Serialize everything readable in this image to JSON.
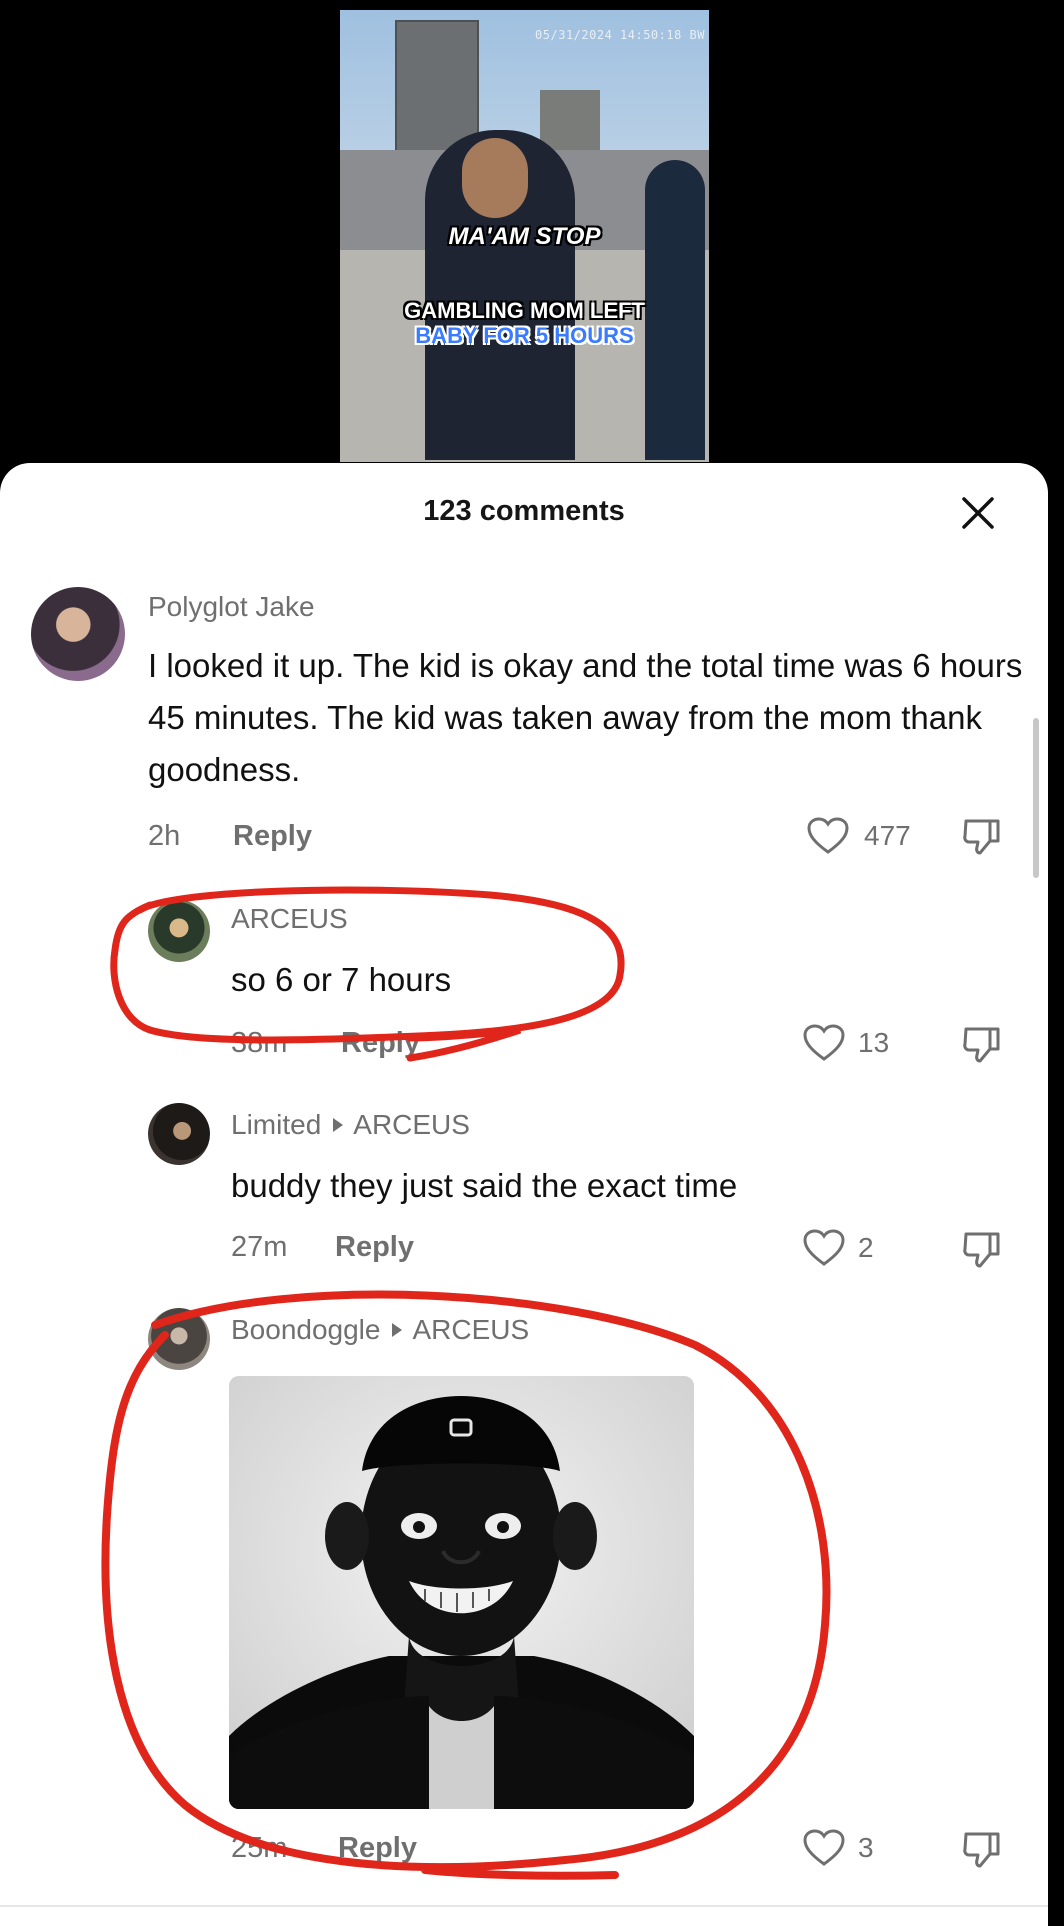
{
  "video": {
    "timestamp": "05/31/2024 14:50:18  BW",
    "caption_1": "MA'AM STOP",
    "caption_2": "GAMBLING MOM LEFT",
    "caption_3": "BABY FOR 5 HOURS"
  },
  "sheet": {
    "title": "123 comments"
  },
  "comments": [
    {
      "author": "Polyglot Jake",
      "text": "I looked it up. The kid is okay and the total time was 6 hours 45 minutes. The kid was taken away from the mom thank goodness.",
      "time": "2h",
      "reply_label": "Reply",
      "likes": "477"
    },
    {
      "author": "ARCEUS",
      "text": "so 6 or 7 hours",
      "time": "38m",
      "reply_label": "Reply",
      "likes": "13"
    },
    {
      "author": "Limited",
      "reply_to": "ARCEUS",
      "text": "buddy they just said the exact time",
      "time": "27m",
      "reply_label": "Reply",
      "likes": "2"
    },
    {
      "author": "Boondoggle",
      "reply_to": "ARCEUS",
      "text": "",
      "time": "25m",
      "reply_label": "Reply",
      "likes": "3"
    }
  ],
  "colors": {
    "annotation_red": "#e0261b",
    "secondary_text": "#6f6f6f"
  },
  "icons": [
    "close-icon",
    "heart-icon",
    "dislike-icon",
    "reply-arrow-icon"
  ]
}
